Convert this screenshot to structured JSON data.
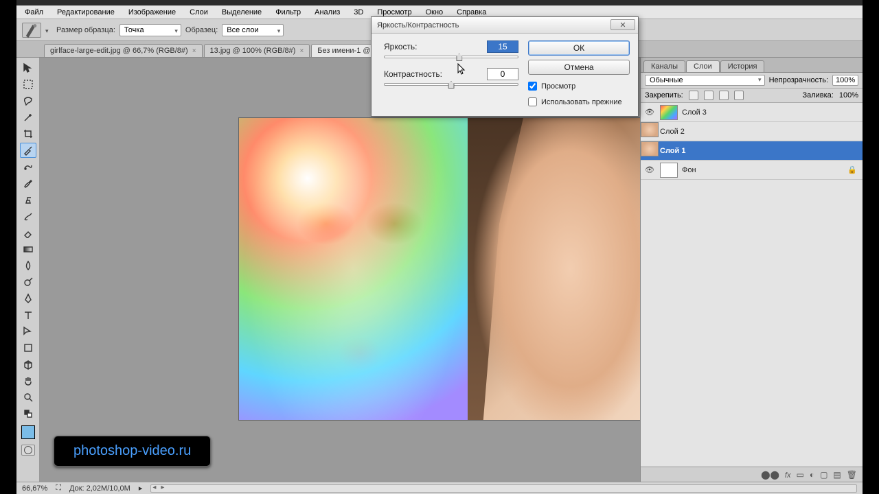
{
  "menu": {
    "items": [
      "Файл",
      "Редактирование",
      "Изображение",
      "Слои",
      "Выделение",
      "Фильтр",
      "Анализ",
      "3D",
      "Просмотр",
      "Окно",
      "Справка"
    ]
  },
  "options": {
    "sample_label": "Размер образца:",
    "sample_value": "Точка",
    "source_label": "Образец:",
    "source_value": "Все слои"
  },
  "tabs": [
    {
      "label": "girlface-large-edit.jpg @ 66,7% (RGB/8#)",
      "active": false
    },
    {
      "label": "13.jpg @ 100% (RGB/8#)",
      "active": false
    },
    {
      "label": "Без имени-1 @",
      "active": true
    }
  ],
  "panel": {
    "tabs": [
      "Каналы",
      "Слои",
      "История"
    ],
    "active_tab": "Слои",
    "blend_value": "Обычные",
    "opacity_label": "Непрозрачность:",
    "opacity_value": "100%",
    "lock_label": "Закрепить:",
    "fill_label": "Заливка:",
    "fill_value": "100%",
    "layers": [
      {
        "name": "Слой 3",
        "thumb": "grad",
        "selected": false
      },
      {
        "name": "Слой 2",
        "thumb": "face",
        "selected": false
      },
      {
        "name": "Слой 1",
        "thumb": "face",
        "selected": true
      },
      {
        "name": "Фон",
        "thumb": "white",
        "selected": false,
        "locked": true
      }
    ]
  },
  "dialog": {
    "title": "Яркость/Контрастность",
    "brightness_label": "Яркость:",
    "brightness_value": "15",
    "contrast_label": "Контрастность:",
    "contrast_value": "0",
    "ok": "ОК",
    "cancel": "Отмена",
    "preview": "Просмотр",
    "legacy": "Использовать прежние",
    "preview_checked": true,
    "legacy_checked": false
  },
  "status": {
    "zoom": "66,67%",
    "doc": "Док: 2,02M/10,0M"
  },
  "watermark": "photoshop-video.ru"
}
